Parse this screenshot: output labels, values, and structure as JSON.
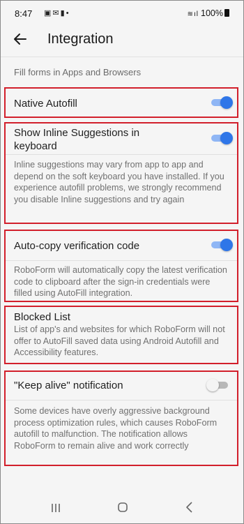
{
  "status_bar": {
    "time": "8:47",
    "notification_icons": [
      "image-icon",
      "mail-icon",
      "clipboard-icon",
      "dot-icon"
    ],
    "battery": "100%"
  },
  "app_bar": {
    "title": "Integration"
  },
  "section": {
    "header": "Fill forms in Apps and Browsers"
  },
  "settings": {
    "native_autofill": {
      "title": "Native Autofill",
      "enabled": true
    },
    "inline_suggestions": {
      "title": "Show Inline Suggestions in keyboard",
      "enabled": true,
      "description": "Inline suggestions may vary from app to app and depend on the soft keyboard you have installed. If you experience autofill problems, we strongly recommend you disable Inline suggestions and try again"
    },
    "auto_copy": {
      "title": "Auto-copy verification code",
      "enabled": true,
      "description": "RoboForm will automatically copy the latest verification code to clipboard after the sign-in credentials were filled using AutoFill integration."
    },
    "blocked_list": {
      "title": "Blocked List",
      "description": "List of app's and websites for which RoboForm will not offer to AutoFill saved data using Android Autofill and Accessibility features."
    },
    "keep_alive": {
      "title": "\"Keep alive\" notification",
      "enabled": false,
      "description": "Some devices have overly aggressive background process optimization rules, which causes RoboForm autofill to malfunction. The notification allows RoboForm to remain alive and work correctly"
    }
  },
  "colors": {
    "highlight": "#d21f2b",
    "toggle_on": "#2f76e8",
    "background": "#f5f5f5"
  }
}
